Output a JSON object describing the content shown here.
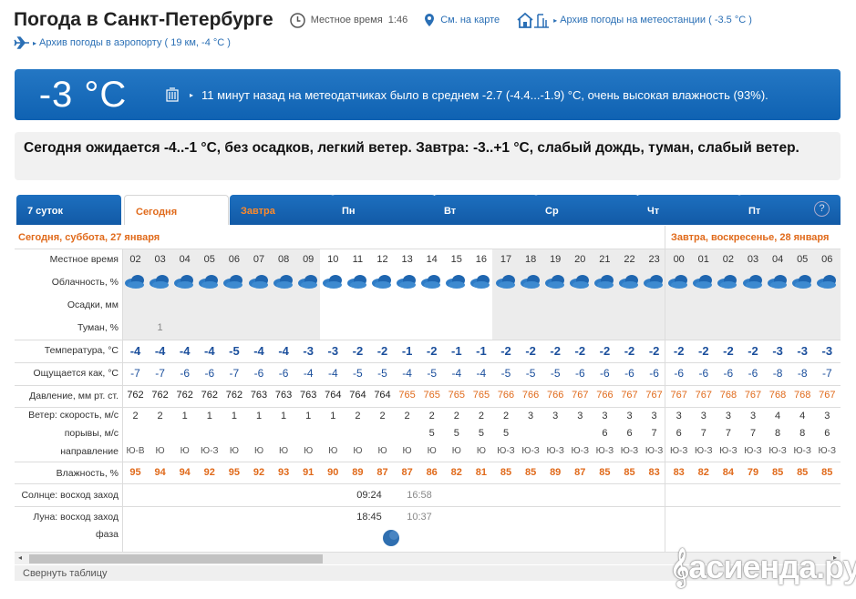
{
  "header": {
    "title": "Погода в Санкт-Петербурге",
    "local_time_label": "Местное время",
    "local_time": "1:46",
    "map_link": "См. на карте",
    "station_link": "Архив погоды на метеостанции ( -3.5 °C )",
    "airport_link": "Архив погоды в аэропорту ( 19 км, -4 °C )"
  },
  "current": {
    "temp": "-3 °C",
    "message": "11 минут назад на метеодатчиках было в среднем -2.7 (-4.4...-1.9) °C, очень высокая влажность (93%)."
  },
  "forecast_text": "Сегодня ожидается -4..-1 °C, без осадков, легкий ветер. Завтра: -3..+1 °C, слабый дождь, туман, слабый ветер.",
  "tabs": [
    "7 суток",
    "Сегодня",
    "Завтра",
    "Пн",
    "Вт",
    "Ср",
    "Чт",
    "Пт"
  ],
  "help": "?",
  "day_headers": {
    "today": "Сегодня, суббота, 27 января",
    "tomorrow": "Завтра, воскресенье, 28 января"
  },
  "labels": {
    "time": "Местное время",
    "cloud": "Облачность, %",
    "precip": "Осадки, мм",
    "fog": "Туман, %",
    "temp": "Температура, °C",
    "feels": "Ощущается как, °C",
    "pressure": "Давление, мм рт. ст.",
    "wind_speed": "Ветер: скорость, м/с",
    "gusts": "порывы, м/с",
    "direction": "направление",
    "humidity": "Влажность, %",
    "sun": "Солнце: восход заход",
    "moon": "Луна: восход заход",
    "phase": "фаза"
  },
  "hours": [
    "02",
    "03",
    "04",
    "05",
    "06",
    "07",
    "08",
    "09",
    "10",
    "11",
    "12",
    "13",
    "14",
    "15",
    "16",
    "17",
    "18",
    "19",
    "20",
    "21",
    "22",
    "23",
    "00",
    "01",
    "02",
    "03",
    "04",
    "05",
    "06"
  ],
  "fog": [
    "",
    "1",
    "",
    "",
    "",
    "",
    "",
    "",
    "",
    "",
    "",
    "",
    "",
    "",
    "",
    "",
    "",
    "",
    "",
    "",
    "",
    "",
    "",
    "",
    "",
    "",
    "",
    "",
    ""
  ],
  "temp": [
    "-4",
    "-4",
    "-4",
    "-4",
    "-5",
    "-4",
    "-4",
    "-3",
    "-3",
    "-2",
    "-2",
    "-1",
    "-2",
    "-1",
    "-1",
    "-2",
    "-2",
    "-2",
    "-2",
    "-2",
    "-2",
    "-2",
    "-2",
    "-2",
    "-2",
    "-2",
    "-3",
    "-3",
    "-3"
  ],
  "feels": [
    "-7",
    "-7",
    "-6",
    "-6",
    "-7",
    "-6",
    "-6",
    "-4",
    "-4",
    "-5",
    "-5",
    "-4",
    "-5",
    "-4",
    "-4",
    "-5",
    "-5",
    "-5",
    "-6",
    "-6",
    "-6",
    "-6",
    "-6",
    "-6",
    "-6",
    "-6",
    "-8",
    "-8",
    "-7"
  ],
  "pressure": [
    "762",
    "762",
    "762",
    "762",
    "762",
    "763",
    "763",
    "763",
    "764",
    "764",
    "764",
    "765",
    "765",
    "765",
    "765",
    "766",
    "766",
    "766",
    "767",
    "766",
    "767",
    "767",
    "767",
    "767",
    "768",
    "767",
    "768",
    "768",
    "767"
  ],
  "wind": [
    "2",
    "2",
    "1",
    "1",
    "1",
    "1",
    "1",
    "1",
    "1",
    "2",
    "2",
    "2",
    "2",
    "2",
    "2",
    "2",
    "3",
    "3",
    "3",
    "3",
    "3",
    "3",
    "3",
    "3",
    "3",
    "3",
    "4",
    "4",
    "3"
  ],
  "gusts": [
    "",
    "",
    "",
    "",
    "",
    "",
    "",
    "",
    "",
    "",
    "",
    "",
    "5",
    "5",
    "5",
    "5",
    "",
    "",
    "",
    "6",
    "6",
    "7",
    "6",
    "7",
    "7",
    "7",
    "8",
    "8",
    "6"
  ],
  "direction": [
    "Ю-В",
    "Ю",
    "Ю",
    "Ю-З",
    "Ю",
    "Ю",
    "Ю",
    "Ю",
    "Ю",
    "Ю",
    "Ю",
    "Ю",
    "Ю",
    "Ю",
    "Ю",
    "Ю-З",
    "Ю-З",
    "Ю-З",
    "Ю-З",
    "Ю-З",
    "Ю-З",
    "Ю-З",
    "Ю-З",
    "Ю-З",
    "Ю-З",
    "Ю-З",
    "Ю-З",
    "Ю-З",
    "Ю-З"
  ],
  "humidity": [
    "95",
    "94",
    "94",
    "92",
    "95",
    "92",
    "93",
    "91",
    "90",
    "89",
    "87",
    "87",
    "86",
    "82",
    "81",
    "85",
    "85",
    "89",
    "87",
    "85",
    "85",
    "83",
    "83",
    "82",
    "84",
    "79",
    "85",
    "85",
    "85"
  ],
  "sun": {
    "rise": "09:24",
    "set": "16:58"
  },
  "moon": {
    "rise": "18:45",
    "set": "10:37"
  },
  "collapse": "Свернуть таблицу",
  "watermark": "асиенда.ру",
  "colors": {
    "accent": "#1565b5",
    "orange": "#e06a1b",
    "blue_text": "#1b4f9c"
  }
}
